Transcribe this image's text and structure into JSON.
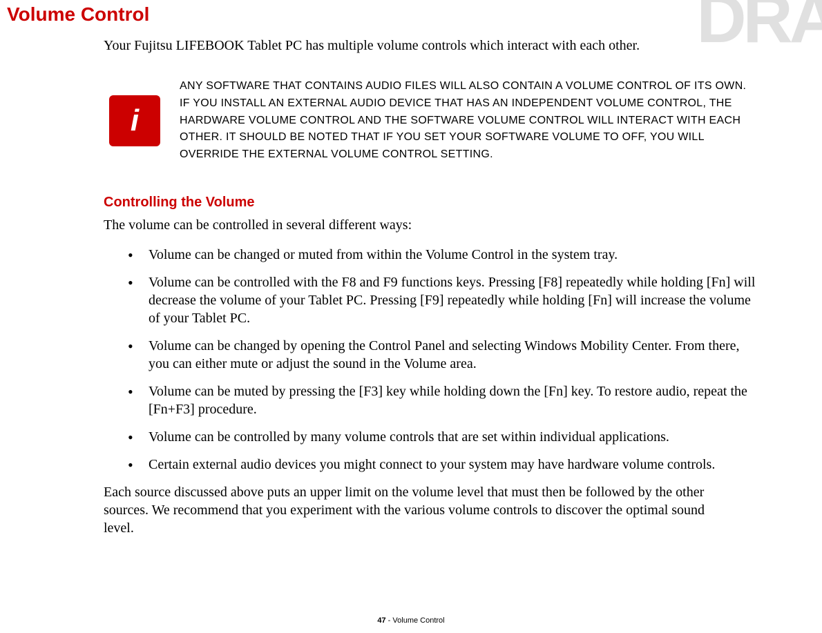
{
  "watermark": "DRA",
  "heading": "Volume Control",
  "intro": "Your Fujitsu LIFEBOOK Tablet PC has multiple volume controls which interact with each other.",
  "info_icon_letter": "i",
  "info_text": "Any software that contains audio files will also contain a volume control of its own. If you install an external audio device that has an independent volume control, the hardware volume control and the software volume control will interact with each other. It should be noted that if you set your software volume to Off, you will override the external volume control setting.",
  "sub_heading": "Controlling the Volume",
  "sub_intro": "The volume can be controlled in several different ways:",
  "bullets": {
    "b1": "Volume can be changed or muted from within the Volume Control in the system tray.",
    "b2": "Volume can be controlled with the F8 and F9 functions keys. Pressing [F8] repeatedly while holding [Fn] will decrease the volume of your Tablet PC. Pressing [F9] repeatedly while holding [Fn] will increase the volume of your Tablet PC.",
    "b3": "Volume can be changed by opening the Control Panel and selecting Windows Mobility Center. From there, you can either mute or adjust the sound in the Volume area.",
    "b4": "Volume can be muted by pressing the [F3] key while holding down the [Fn] key. To restore audio, repeat the [Fn+F3] procedure.",
    "b5": "Volume can be controlled by many volume controls that are set within individual applications.",
    "b6": "Certain external audio devices you might connect to your system may have hardware volume controls."
  },
  "closing": "Each source discussed above puts an upper limit on the volume level that must then be followed by the other sources. We recommend that you experiment with the various volume controls to discover the optimal sound level.",
  "footer": {
    "page": "47",
    "separator": " - ",
    "title": "Volume Control"
  }
}
